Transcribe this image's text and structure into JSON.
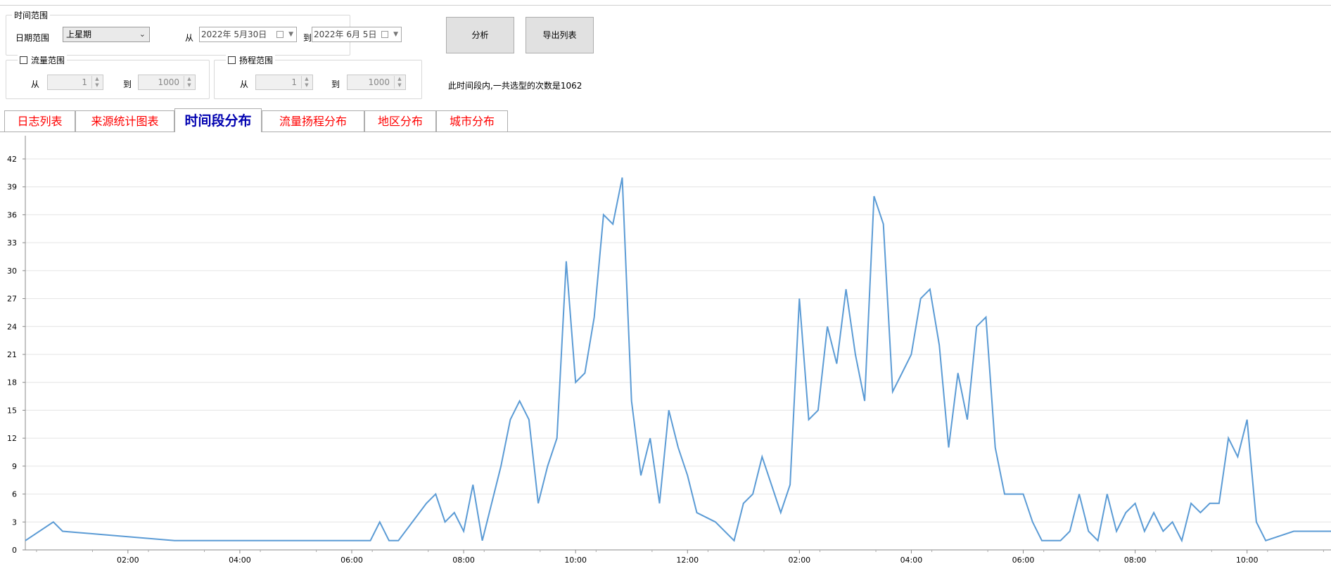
{
  "time_range": {
    "legend": "时间范围",
    "date_range_label": "日期范围",
    "date_range_value": "上星期",
    "from_label": "从",
    "from_date": "2022年 5月30日",
    "to_label": "到",
    "to_date": "2022年 6月 5日"
  },
  "flow_range": {
    "legend": "流量范围",
    "from_label": "从",
    "from_value": "1",
    "to_label": "到",
    "to_value": "1000"
  },
  "head_range": {
    "legend": "扬程范围",
    "from_label": "从",
    "from_value": "1",
    "to_label": "到",
    "to_value": "1000"
  },
  "buttons": {
    "analyze": "分析",
    "export": "导出列表"
  },
  "result_text": "此时间段内,一共选型的次数是1062",
  "tabs": [
    {
      "label": "日志列表"
    },
    {
      "label": "来源统计图表"
    },
    {
      "label": "时间段分布"
    },
    {
      "label": "流量扬程分布"
    },
    {
      "label": "地区分布"
    },
    {
      "label": "城市分布"
    }
  ],
  "colors": {
    "series": "#5b9bd5",
    "grid": "#e4e4e4",
    "active_tab": "#0000b0",
    "inactive_tab": "#ff0000"
  },
  "chart_data": {
    "type": "line",
    "title": "",
    "xlabel": "",
    "ylabel": "",
    "ylim": [
      0,
      42
    ],
    "yticks": [
      0,
      3,
      6,
      9,
      12,
      15,
      18,
      21,
      24,
      27,
      30,
      33,
      36,
      39,
      42
    ],
    "xlim_hours": [
      0.2,
      35.2
    ],
    "x_ticks": [
      {
        "hour": 2.95,
        "label": "02:00"
      },
      {
        "hour": 5.95,
        "label": "04:00"
      },
      {
        "hour": 8.95,
        "label": "06:00"
      },
      {
        "hour": 11.95,
        "label": "08:00"
      },
      {
        "hour": 14.95,
        "label": "10:00"
      },
      {
        "hour": 17.95,
        "label": "12:00"
      },
      {
        "hour": 20.95,
        "label": "02:00"
      },
      {
        "hour": 23.95,
        "label": "04:00"
      },
      {
        "hour": 26.95,
        "label": "06:00"
      },
      {
        "hour": 29.95,
        "label": "08:00"
      },
      {
        "hour": 32.95,
        "label": "10:00"
      }
    ],
    "grid": true,
    "series": [
      {
        "x": [
          0.2,
          0.95,
          1.2,
          4.2,
          9.45,
          9.7,
          9.95,
          10.2,
          10.95,
          11.2,
          11.45,
          11.7,
          11.95,
          12.2,
          12.45,
          12.95,
          13.2,
          13.45,
          13.7,
          13.95,
          14.2,
          14.45,
          14.7,
          14.95,
          15.2,
          15.45,
          15.7,
          15.95,
          16.2,
          16.45,
          16.7,
          16.95,
          17.2,
          17.45,
          17.7,
          17.95,
          18.2,
          18.7,
          19.2,
          19.45,
          19.7,
          19.95,
          20.2,
          20.45,
          20.7,
          20.95,
          21.2,
          21.45,
          21.7,
          21.95,
          22.2,
          22.45,
          22.7,
          22.95,
          23.2,
          23.45,
          23.7,
          23.95,
          24.2,
          24.45,
          24.7,
          24.95,
          25.2,
          25.45,
          25.7,
          25.95,
          26.2,
          26.45,
          26.95,
          27.2,
          27.45,
          27.95,
          28.2,
          28.45,
          28.7,
          28.95,
          29.2,
          29.45,
          29.7,
          29.95,
          30.2,
          30.45,
          30.7,
          30.95,
          31.2,
          31.45,
          31.7,
          31.95,
          32.2,
          32.45,
          32.7,
          32.95,
          33.2,
          33.45,
          34.2,
          35.2
        ],
        "y": [
          1,
          3,
          2,
          1,
          1,
          3,
          1,
          1,
          5,
          6,
          3,
          4,
          2,
          7,
          1,
          9,
          14,
          16,
          14,
          5,
          9,
          12,
          31,
          18,
          19,
          25,
          36,
          35,
          40,
          16,
          8,
          12,
          5,
          15,
          11,
          8,
          4,
          3,
          1,
          5,
          6,
          10,
          7,
          4,
          7,
          27,
          14,
          15,
          24,
          20,
          28,
          21,
          16,
          38,
          35,
          17,
          19,
          21,
          27,
          28,
          22,
          11,
          19,
          14,
          24,
          25,
          11,
          6,
          6,
          3,
          1,
          1,
          2,
          6,
          2,
          1,
          6,
          2,
          4,
          5,
          2,
          4,
          2,
          3,
          1,
          5,
          4,
          5,
          5,
          12,
          10,
          14,
          3,
          1,
          2,
          2
        ]
      }
    ]
  }
}
